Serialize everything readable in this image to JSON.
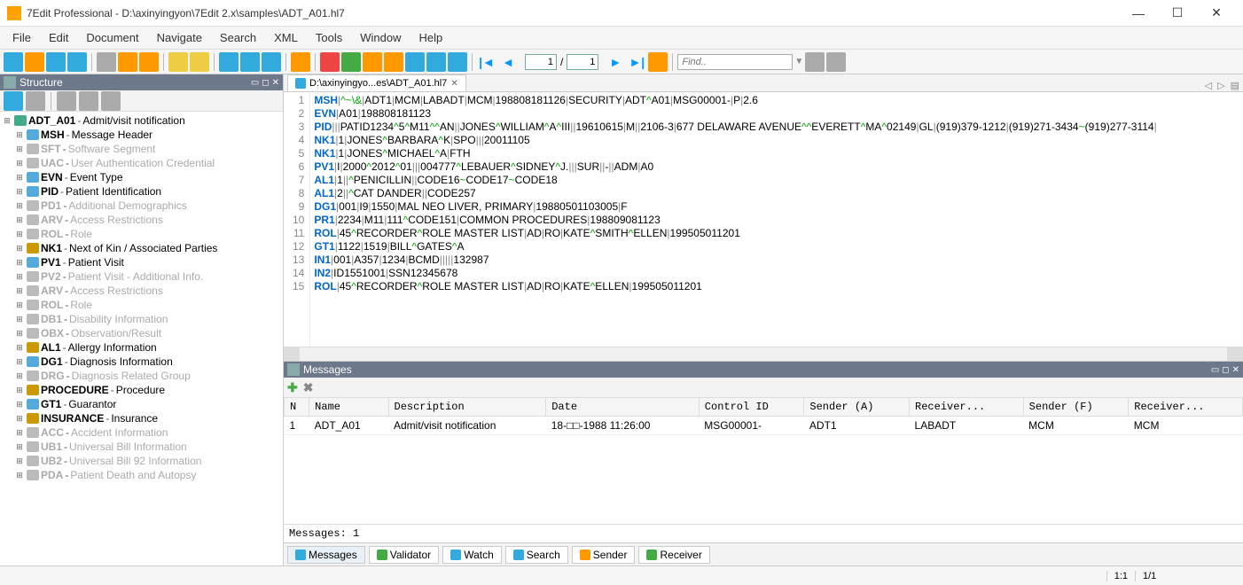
{
  "window": {
    "title": "7Edit Professional - D:\\axinyingyon\\7Edit 2.x\\samples\\ADT_A01.hl7"
  },
  "menu": [
    "File",
    "Edit",
    "Document",
    "Navigate",
    "Search",
    "XML",
    "Tools",
    "Window",
    "Help"
  ],
  "toolbar": {
    "page_current": "1",
    "page_sep": "/",
    "page_total": "1",
    "find_placeholder": "Find.."
  },
  "structure": {
    "title": "Structure",
    "root": {
      "seg": "ADT_A01",
      "desc": "Admit/visit notification",
      "icon": "ic-m",
      "dim": false,
      "depth": 0
    },
    "nodes": [
      {
        "seg": "MSH",
        "desc": "Message Header",
        "icon": "ic-s",
        "dim": false
      },
      {
        "seg": "SFT",
        "desc": "Software Segment",
        "icon": "ic-g",
        "dim": true
      },
      {
        "seg": "UAC",
        "desc": "User Authentication Credential",
        "icon": "ic-g",
        "dim": true
      },
      {
        "seg": "EVN",
        "desc": "Event Type",
        "icon": "ic-s",
        "dim": false
      },
      {
        "seg": "PID",
        "desc": "Patient Identification",
        "icon": "ic-s",
        "dim": false
      },
      {
        "seg": "PD1",
        "desc": "Additional Demographics",
        "icon": "ic-g",
        "dim": true
      },
      {
        "seg": "ARV",
        "desc": "Access Restrictions",
        "icon": "ic-g",
        "dim": true
      },
      {
        "seg": "ROL",
        "desc": "Role",
        "icon": "ic-g",
        "dim": true
      },
      {
        "seg": "NK1",
        "desc": "Next of Kin / Associated Parties",
        "icon": "ic-gold",
        "dim": false
      },
      {
        "seg": "PV1",
        "desc": "Patient Visit",
        "icon": "ic-s",
        "dim": false
      },
      {
        "seg": "PV2",
        "desc": "Patient Visit - Additional Info.",
        "icon": "ic-g",
        "dim": true
      },
      {
        "seg": "ARV",
        "desc": "Access Restrictions",
        "icon": "ic-g",
        "dim": true
      },
      {
        "seg": "ROL",
        "desc": "Role",
        "icon": "ic-g",
        "dim": true
      },
      {
        "seg": "DB1",
        "desc": "Disability Information",
        "icon": "ic-g",
        "dim": true
      },
      {
        "seg": "OBX",
        "desc": "Observation/Result",
        "icon": "ic-g",
        "dim": true
      },
      {
        "seg": "AL1",
        "desc": "Allergy Information",
        "icon": "ic-gold",
        "dim": false
      },
      {
        "seg": "DG1",
        "desc": "Diagnosis Information",
        "icon": "ic-s",
        "dim": false
      },
      {
        "seg": "DRG",
        "desc": "Diagnosis Related Group",
        "icon": "ic-g",
        "dim": true
      },
      {
        "seg": "PROCEDURE",
        "desc": "Procedure",
        "icon": "ic-gold",
        "dim": false
      },
      {
        "seg": "GT1",
        "desc": "Guarantor",
        "icon": "ic-s",
        "dim": false
      },
      {
        "seg": "INSURANCE",
        "desc": "Insurance",
        "icon": "ic-gold",
        "dim": false
      },
      {
        "seg": "ACC",
        "desc": "Accident Information",
        "icon": "ic-g",
        "dim": true
      },
      {
        "seg": "UB1",
        "desc": "Universal Bill Information",
        "icon": "ic-g",
        "dim": true
      },
      {
        "seg": "UB2",
        "desc": "Universal Bill 92 Information",
        "icon": "ic-g",
        "dim": true
      },
      {
        "seg": "PDA",
        "desc": "Patient Death and Autopsy",
        "icon": "ic-g",
        "dim": true
      }
    ]
  },
  "tab": {
    "label": "D:\\axinyingyo...es\\ADT_A01.hl7"
  },
  "lines": [
    {
      "seg": "MSH",
      "rest": "|^~\\&|ADT1|MCM|LABADT|MCM|198808181126|SECURITY|ADT^A01|MSG00001-|P|2.6"
    },
    {
      "seg": "EVN",
      "rest": "|A01|198808181123"
    },
    {
      "seg": "PID",
      "rest": "|||PATID1234^5^M11^^AN||JONES^WILLIAM^A^III||19610615|M||2106-3|677 DELAWARE AVENUE^^EVERETT^MA^02149|GL|(919)379-1212|(919)271-3434~(919)277-3114|"
    },
    {
      "seg": "NK1",
      "rest": "|1|JONES^BARBARA^K|SPO|||20011105"
    },
    {
      "seg": "NK1",
      "rest": "|1|JONES^MICHAEL^A|FTH"
    },
    {
      "seg": "PV1",
      "rest": "|I|2000^2012^01|||004777^LEBAUER^SIDNEY^J.|||SUR||-||ADM|A0"
    },
    {
      "seg": "AL1",
      "rest": "|1||^PENICILLIN||CODE16~CODE17~CODE18"
    },
    {
      "seg": "AL1",
      "rest": "|2||^CAT DANDER||CODE257"
    },
    {
      "seg": "DG1",
      "rest": "|001|I9|1550|MAL NEO LIVER, PRIMARY|19880501103005|F"
    },
    {
      "seg": "PR1",
      "rest": "|2234|M11|111^CODE151|COMMON PROCEDURES|198809081123"
    },
    {
      "seg": "ROL",
      "rest": "|45^RECORDER^ROLE MASTER LIST|AD|RO|KATE^SMITH^ELLEN|199505011201"
    },
    {
      "seg": "GT1",
      "rest": "|1122|1519|BILL^GATES^A"
    },
    {
      "seg": "IN1",
      "rest": "|001|A357|1234|BCMD|||||132987"
    },
    {
      "seg": "IN2",
      "rest": "|ID1551001|SSN12345678"
    },
    {
      "seg": "ROL",
      "rest": "|45^RECORDER^ROLE MASTER LIST|AD|RO|KATE^ELLEN|199505011201"
    }
  ],
  "messages": {
    "title": "Messages",
    "columns": [
      "N",
      "Name",
      "Description",
      "Date",
      "Control ID",
      "Sender (A)",
      "Receiver...",
      "Sender (F)",
      "Receiver..."
    ],
    "rows": [
      {
        "n": "1",
        "name": "ADT_A01",
        "description": "Admit/visit notification",
        "date": "18-□□-1988 11:26:00",
        "control_id": "MSG00001-",
        "sender_a": "ADT1",
        "receiver_a": "LABADT",
        "sender_f": "MCM",
        "receiver_f": "MCM"
      }
    ],
    "status": "Messages: 1"
  },
  "bottom_tabs": [
    {
      "label": "Messages",
      "color": "i-blue",
      "active": true
    },
    {
      "label": "Validator",
      "color": "i-green",
      "active": false
    },
    {
      "label": "Watch",
      "color": "i-blue",
      "active": false
    },
    {
      "label": "Search",
      "color": "i-blue",
      "active": false
    },
    {
      "label": "Sender",
      "color": "i-orange",
      "active": false
    },
    {
      "label": "Receiver",
      "color": "i-green",
      "active": false
    }
  ],
  "status": {
    "pos": "1:1",
    "page": "1/1"
  }
}
